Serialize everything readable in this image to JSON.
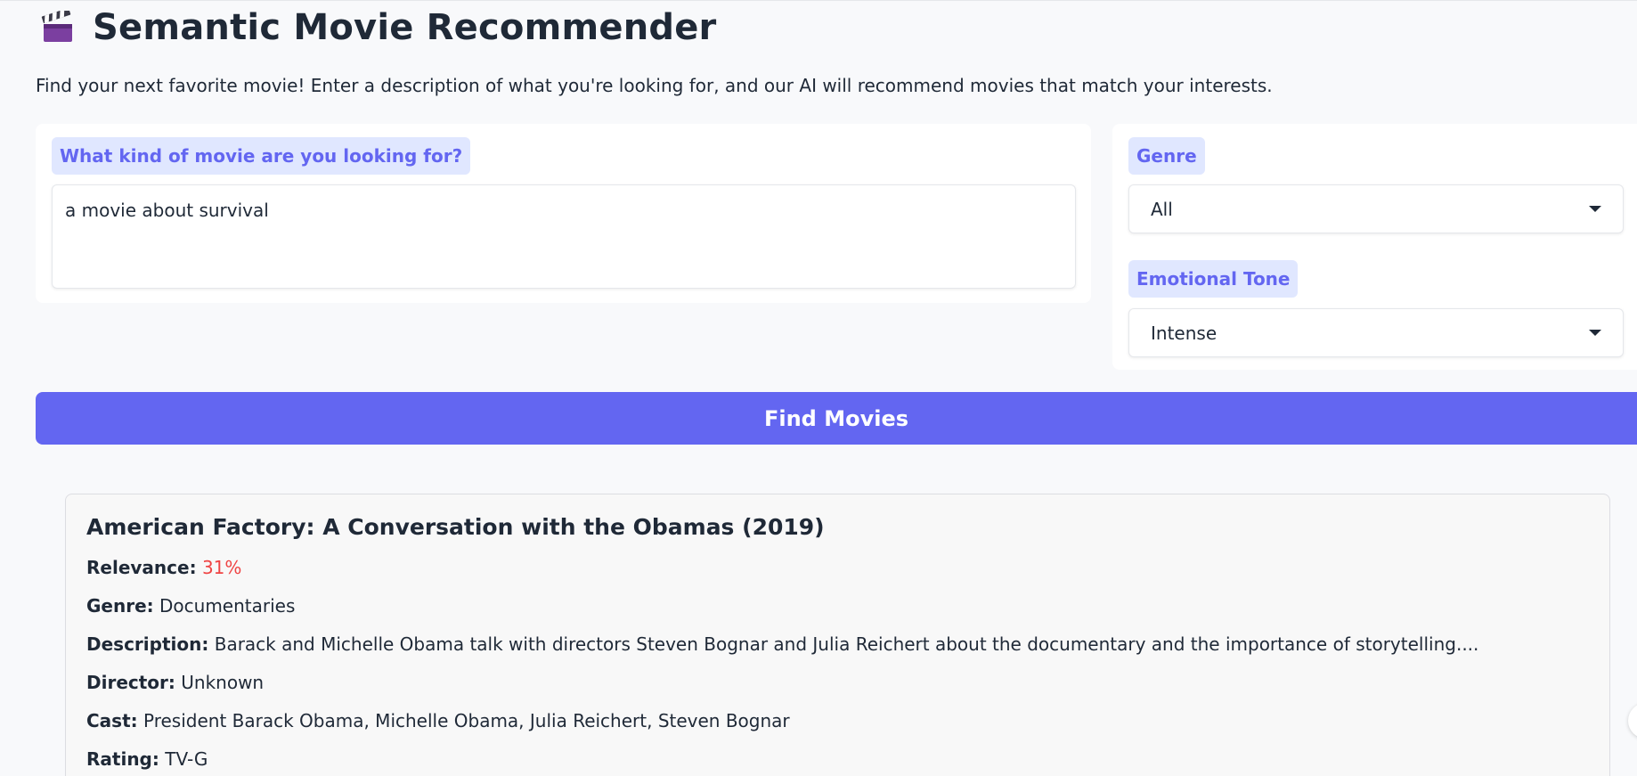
{
  "header": {
    "title": "Semantic Movie Recommender",
    "icon": "clapperboard-icon",
    "intro": "Find your next favorite movie! Enter a description of what you're looking for, and our AI will recommend movies that match your interests."
  },
  "query": {
    "label": "What kind of movie are you looking for?",
    "value": "a movie about survival"
  },
  "filters": {
    "genre_label": "Genre",
    "genre_value": "All",
    "tone_label": "Emotional Tone",
    "tone_value": "Intense"
  },
  "actions": {
    "find_label": "Find Movies"
  },
  "result": {
    "title": "American Factory: A Conversation with the Obamas (2019)",
    "relevance_label": "Relevance:",
    "relevance_value": "31%",
    "genre_label": "Genre:",
    "genre_value": "Documentaries",
    "description_label": "Description:",
    "description_value": "Barack and Michelle Obama talk with directors Steven Bognar and Julia Reichert about the documentary and the importance of storytelling....",
    "director_label": "Director:",
    "director_value": "Unknown",
    "cast_label": "Cast:",
    "cast_value": "President Barack Obama, Michelle Obama, Julia Reichert, Steven Bognar",
    "rating_label": "Rating:",
    "rating_value": "TV-G"
  },
  "colors": {
    "accent": "#6366f1",
    "chip_bg": "#e0e7ff",
    "relevance": "#ef4444",
    "background": "#f8f9fb"
  }
}
